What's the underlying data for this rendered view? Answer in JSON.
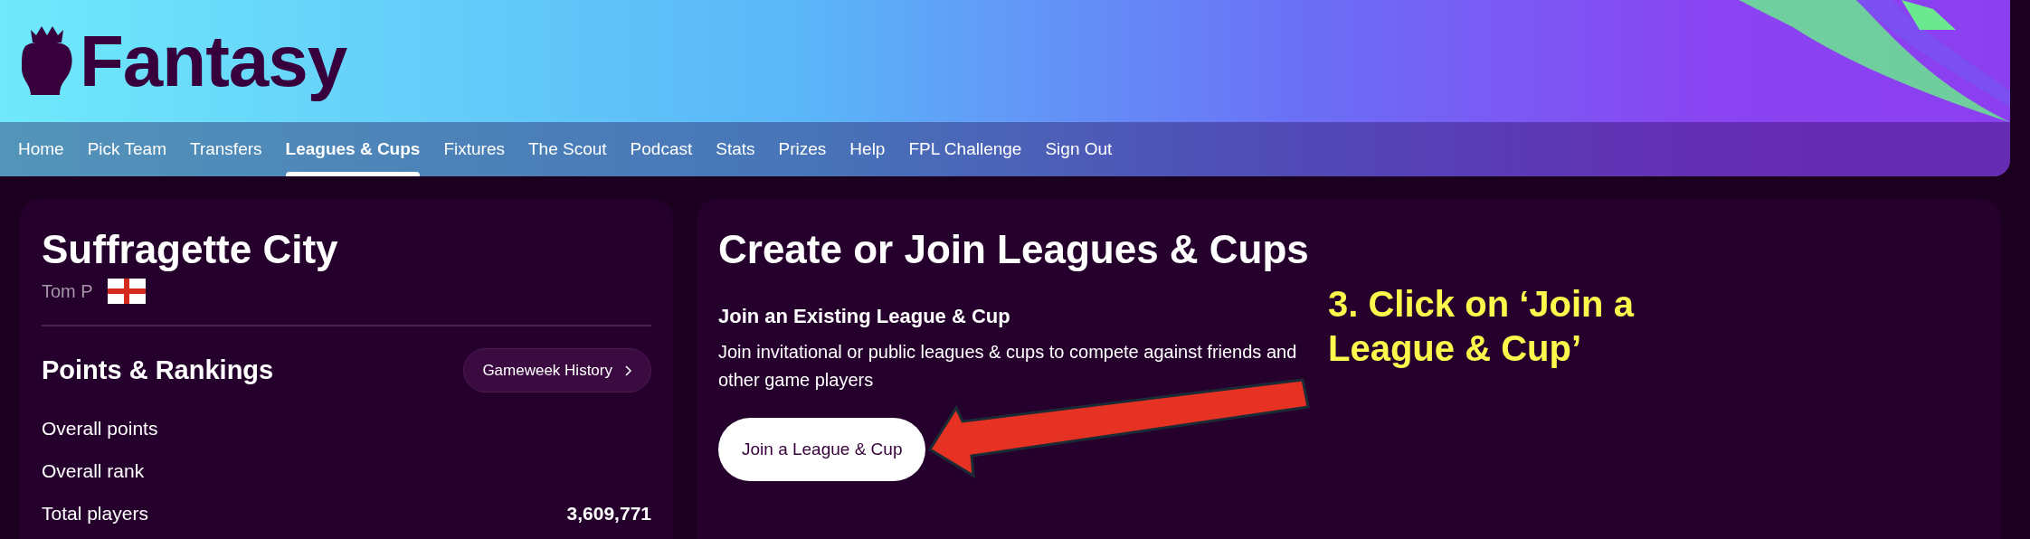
{
  "header": {
    "logo_text": "Fantasy"
  },
  "nav": [
    {
      "label": "Home",
      "selected": false
    },
    {
      "label": "Pick Team",
      "selected": false
    },
    {
      "label": "Transfers",
      "selected": false
    },
    {
      "label": "Leagues & Cups",
      "selected": true
    },
    {
      "label": "Fixtures",
      "selected": false
    },
    {
      "label": "The Scout",
      "selected": false
    },
    {
      "label": "Podcast",
      "selected": false
    },
    {
      "label": "Stats",
      "selected": false
    },
    {
      "label": "Prizes",
      "selected": false
    },
    {
      "label": "Help",
      "selected": false
    },
    {
      "label": "FPL Challenge",
      "selected": false
    },
    {
      "label": "Sign Out",
      "selected": false
    }
  ],
  "team_card": {
    "team_name": "Suffragette City",
    "manager": "Tom P",
    "section_title": "Points & Rankings",
    "history_button": "Gameweek History",
    "rows": [
      {
        "label": "Overall points"
      },
      {
        "label": "Overall rank"
      },
      {
        "label": "Total players",
        "value": "3,609,771"
      }
    ]
  },
  "join_card": {
    "title": "Create or Join Leagues & Cups",
    "subtitle": "Join an Existing League & Cup",
    "description": "Join invitational or public leagues & cups to compete against friends and other game players",
    "button": "Join a League & Cup"
  },
  "annotation": {
    "lines": [
      "3. Click on ‘Join a",
      "League & Cup’"
    ]
  }
}
